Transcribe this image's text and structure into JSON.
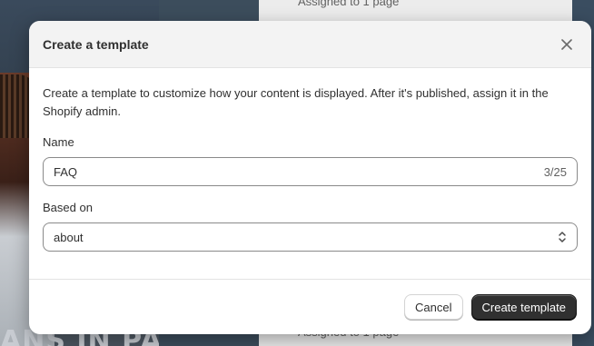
{
  "background": {
    "top_caption": "Assigned to 1 page",
    "bottom_caption": "Assigned to 1 page",
    "poster_text": "ANS IN PARIS"
  },
  "modal": {
    "title": "Create a template",
    "close_icon": "close-icon",
    "description": "Create a template to customize how your content is displayed. After it's published, assign it in the Shopify admin.",
    "name_field": {
      "label": "Name",
      "value": "FAQ",
      "char_count": "3/25"
    },
    "based_on_field": {
      "label": "Based on",
      "value": "about",
      "icon": "select-chevron-icon"
    },
    "footer": {
      "cancel_label": "Cancel",
      "create_label": "Create template"
    }
  },
  "colors": {
    "primary_button": "#303030",
    "header_bg": "#f3f3f3",
    "text": "#303030"
  }
}
